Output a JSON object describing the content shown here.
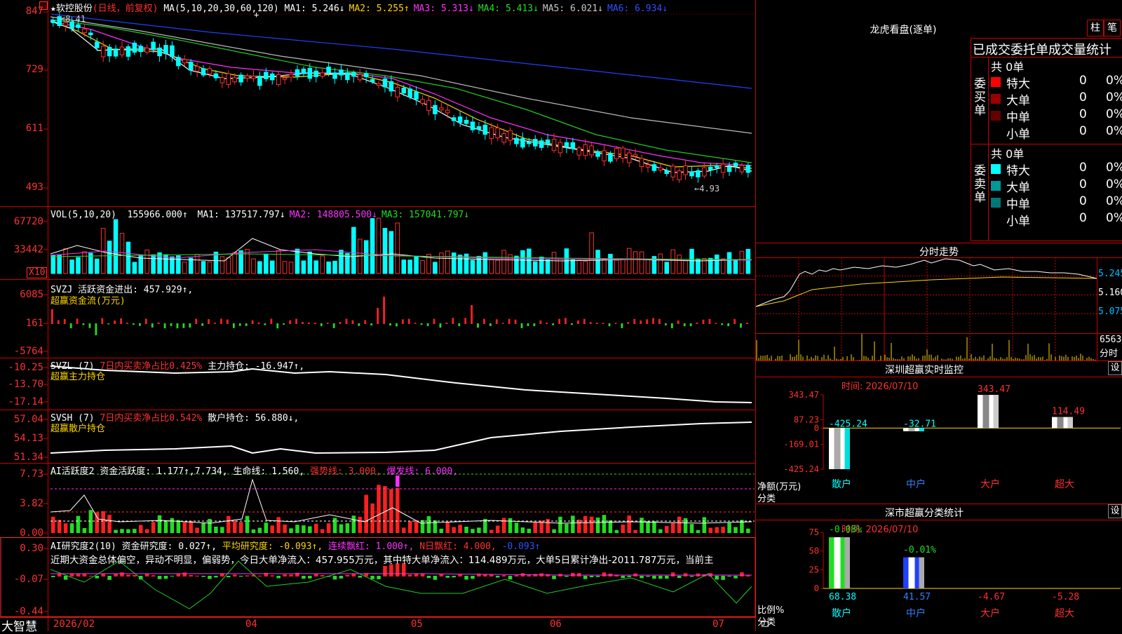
{
  "app": {
    "brand": "大智慧",
    "window_icon": "kline-window-icon"
  },
  "colors": {
    "bg": "#000000",
    "up": "#ff3030",
    "down": "#00ffff",
    "grid": "#cc0000",
    "green": "#22dd22",
    "yellow": "#ffd700",
    "magenta": "#ff30ff",
    "white": "#ffffff",
    "blue": "#2040ff"
  },
  "main": {
    "star": "★",
    "stock_name": "软控股份",
    "period": "(日线，前复权)",
    "ma_params": "MA(5,10,20,30,60,120)",
    "ma_items": [
      {
        "text": "MA1: 5.246↓",
        "color": "#ffffff"
      },
      {
        "text": "MA2: 5.255↑",
        "color": "#ffd700"
      },
      {
        "text": "MA3: 5.313↓",
        "color": "#ff30ff"
      },
      {
        "text": "MA4: 5.413↓",
        "color": "#22dd22"
      },
      {
        "text": "MA5: 6.021↓",
        "color": "#c8c8c8"
      },
      {
        "text": "MA6: 6.934↓",
        "color": "#3050ff"
      }
    ],
    "y_ticks": [
      "847",
      "729",
      "611",
      "493"
    ],
    "high_mark": "8.41",
    "low_mark": "←4.93"
  },
  "vol": {
    "title": "VOL(5,10,20)",
    "value": "155966.000↑",
    "items": [
      {
        "text": "MA1: 137517.797↓",
        "color": "#ffffff"
      },
      {
        "text": "MA2: 148805.500↓",
        "color": "#ff30ff"
      },
      {
        "text": "MA3: 157041.797↓",
        "color": "#22dd22"
      }
    ],
    "y_ticks": [
      "67720",
      "33442"
    ],
    "unit": "X10"
  },
  "svzj": {
    "title": "SVZJ  活跃资金进出: 457.929↑,",
    "subtitle": "超赢资金流(万元)",
    "y_ticks": [
      "6085",
      "161",
      "-5764"
    ]
  },
  "svzl": {
    "title": "SVZL (7)",
    "t2": "7日内买卖净占比0.425%",
    "t3": "主力持仓: -16.947↑,",
    "subtitle": "超赢主力持仓",
    "y_ticks": [
      "-10.25",
      "-13.70",
      "-17.14"
    ]
  },
  "svsh": {
    "title": "SVSH (7)",
    "t2": "7日内买卖净占比0.542%",
    "t3": "散户持仓: 56.880↓,",
    "subtitle": "超赢散户持仓",
    "y_ticks": [
      "57.04",
      "54.13",
      "51.34"
    ]
  },
  "ai1": {
    "t1": "AI活跃度2",
    "t2": "资金活跃度: 1.177↑,7.734,",
    "t3": "生命线: 1.560,",
    "t4": "强势线: 3.000,",
    "t5": "爆发线: 6.000,",
    "y_ticks": [
      "7.73",
      "3.82",
      "0.00"
    ]
  },
  "ai2": {
    "t1": "AI研究度2(10)",
    "t2": "资金研究度: 0.027↑,",
    "t3": "平均研究度: -0.093↑,",
    "t4": "连续飘红: 1.000↑,",
    "t5": "N日飘红: 4.000,",
    "t6": "-0.093↑",
    "comment": "近期大资金总体偏空，异动不明显，偏弱势，今日大单净流入：457.955万元，其中特大单净流入：114.489万元，大单5日累计净出-2011.787万元，当前主",
    "y_ticks": [
      "0.30",
      "-0.07",
      "-0.44"
    ]
  },
  "xaxis": {
    "labels": [
      "2026/02",
      "04",
      "05",
      "06",
      "07"
    ]
  },
  "dragon": {
    "title": "龙虎看盘(逐单)",
    "btn1": "柱",
    "btn2": "笔",
    "header": "已成交委托单成交量统计",
    "buy_label": "委买单",
    "sell_label": "委卖单",
    "buy_total": "共 0单",
    "sell_total": "共 0单",
    "buy_rows": [
      {
        "name": "特大",
        "color": "#ff0000",
        "v": "0",
        "p": "0%"
      },
      {
        "name": "大单",
        "color": "#990000",
        "v": "0",
        "p": "0%"
      },
      {
        "name": "中单",
        "color": "#660000",
        "v": "0",
        "p": "0%"
      },
      {
        "name": "小单",
        "color": "",
        "v": "0",
        "p": "0%"
      }
    ],
    "sell_rows": [
      {
        "name": "特大",
        "color": "#00ffff",
        "v": "0",
        "p": "0%"
      },
      {
        "name": "大单",
        "color": "#009999",
        "v": "0",
        "p": "0%"
      },
      {
        "name": "中单",
        "color": "#007777",
        "v": "0",
        "p": "0%"
      },
      {
        "name": "小单",
        "color": "",
        "v": "0",
        "p": "0%"
      }
    ]
  },
  "fenshi": {
    "title": "分时走势",
    "y_ticks": [
      "5.245",
      "5.160",
      "5.075"
    ],
    "vol_tick": "6563",
    "vol_label": "分时"
  },
  "sz1": {
    "title": "深圳超赢实时监控",
    "set_btn": "设",
    "time": "时间: 2026/07/10",
    "y_ticks": [
      "343.47",
      "87.23",
      "0",
      "-169.01",
      "-425.24"
    ],
    "ylabel1": "净额(万元)",
    "ylabel2": "分类",
    "chart_data": {
      "type": "bar",
      "categories": [
        "散户",
        "中户",
        "大户",
        "超大"
      ],
      "values": [
        -425.24,
        -32.71,
        343.47,
        114.49
      ],
      "value_labels": [
        "-425.24",
        "-32.71",
        "343.47",
        "114.49"
      ],
      "ylim": [
        -425.24,
        343.47
      ]
    }
  },
  "sz2": {
    "title": "深市超赢分类统计",
    "set_btn": "设",
    "time": "时间: 2026/07/10",
    "y_ticks": [
      "75",
      "50",
      "25",
      "0"
    ],
    "ylabel1": "比例%",
    "ylabel2": "分类",
    "change_labels": [
      "-0.08%",
      "-0.01%"
    ],
    "chart_data": {
      "type": "bar",
      "categories": [
        "散户",
        "中户",
        "大户",
        "超大"
      ],
      "values": [
        68.38,
        41.57,
        -4.67,
        -5.28
      ],
      "value_labels": [
        "68.38",
        "41.57",
        "-4.67",
        "-5.28"
      ],
      "ylim": [
        0,
        75
      ]
    }
  }
}
